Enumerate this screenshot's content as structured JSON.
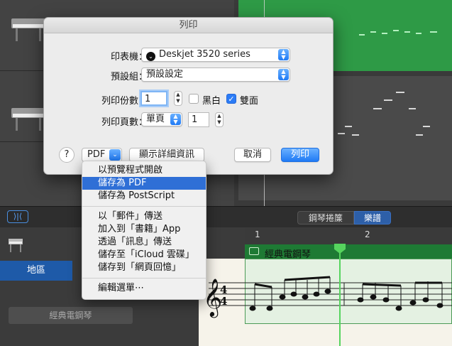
{
  "background": {
    "editor_tabs": {
      "piano_roll": "鋼琴捲簾",
      "score": "樂譜"
    },
    "region_tab": "地區",
    "region_name": "經典電鋼琴",
    "ruler_marks": [
      "1",
      "2"
    ],
    "score_region_label": "經典電鋼琴",
    "catch_button": "⟩|⟨"
  },
  "dialog": {
    "title": "列印",
    "printer_label": "印表機：",
    "printer_value": "Deskjet 3520 series",
    "preset_label": "預設組：",
    "preset_value": "預設設定",
    "copies_label": "列印份數：",
    "copies_value": "1",
    "bw_label": "黑白",
    "bw_checked": false,
    "duplex_label": "雙面",
    "duplex_checked": true,
    "pages_label": "列印頁數：",
    "pages_value": "單頁",
    "pages_count": "1",
    "help_label": "?",
    "pdf_label": "PDF",
    "details_label": "顯示詳細資訊",
    "cancel_label": "取消",
    "print_label": "列印",
    "accent_color": "#1f7af5"
  },
  "pdf_menu": {
    "group1": [
      "以預覽程式開啟",
      "儲存為 PDF",
      "儲存為 PostScript"
    ],
    "highlighted": "儲存為 PDF",
    "group2": [
      "以「郵件」傳送",
      "加入到「書籍」App",
      "透過「訊息」傳送",
      "儲存至「iCloud 雲碟」",
      "儲存到「網頁回憶」"
    ],
    "group3": [
      "編輯選單⋯"
    ]
  }
}
